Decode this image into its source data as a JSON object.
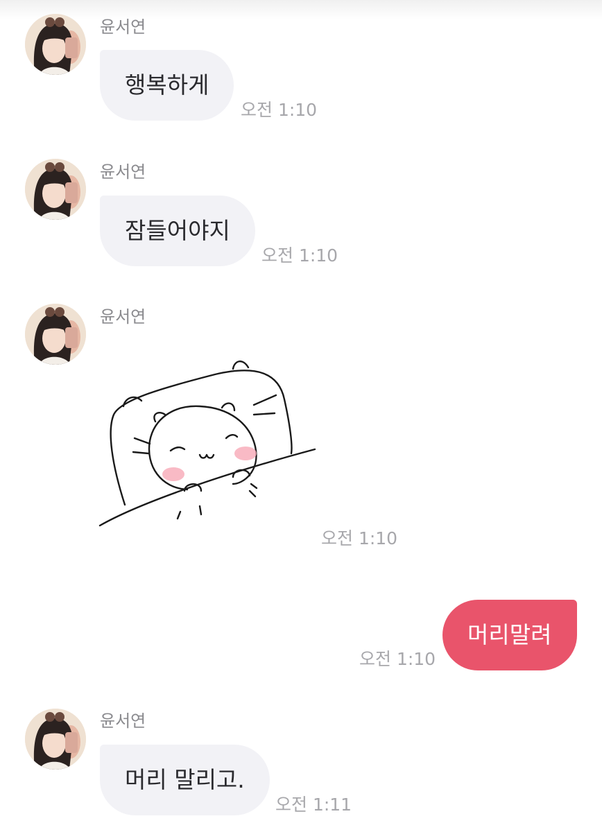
{
  "colors": {
    "incoming_bubble": "#f2f2f6",
    "outgoing_bubble": "#e9546b",
    "timestamp": "#a7a7ab",
    "sender_name": "#8a8a8e"
  },
  "messages": [
    {
      "direction": "incoming",
      "sender": "윤서연",
      "text": "행복하게",
      "time": "오전 1:10"
    },
    {
      "direction": "incoming",
      "sender": "윤서연",
      "text": "잠들어야지",
      "time": "오전 1:10"
    },
    {
      "direction": "incoming",
      "sender": "윤서연",
      "sticker": "sleeping-cat-sticker",
      "time": "오전 1:10"
    },
    {
      "direction": "outgoing",
      "text": "머리말려",
      "time": "오전 1:10"
    },
    {
      "direction": "incoming",
      "sender": "윤서연",
      "text": "머리 말리고.",
      "time": "오전 1:11"
    }
  ]
}
